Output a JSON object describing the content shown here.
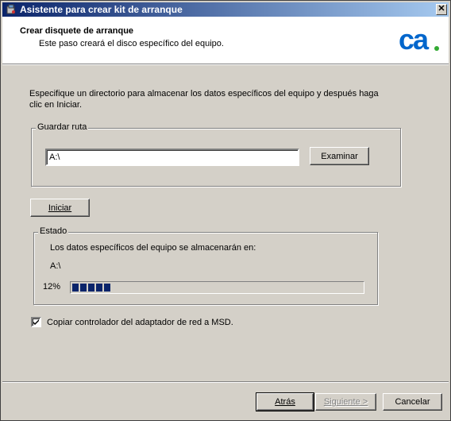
{
  "window": {
    "title": "Asistente para crear kit de arranque",
    "close_glyph": "✕"
  },
  "header": {
    "title": "Crear disquete de arranque",
    "subtitle": "Este paso creará el disco específico del equipo.",
    "logo_text": "ca"
  },
  "instructions": "Especifique un directorio para almacenar los datos específicos del equipo y después haga clic en Iniciar.",
  "save_path": {
    "group_label": "Guardar ruta",
    "value": "A:\\",
    "browse_label": "Examinar"
  },
  "start_button": {
    "label": "Iniciar"
  },
  "status": {
    "group_label": "Estado",
    "message": "Los datos específicos del equipo se almacenarán en:",
    "path": "A:\\",
    "progress_text": "12%",
    "progress": 12
  },
  "copy_driver": {
    "checked": true,
    "label": "Copiar controlador del adaptador de red a MSD."
  },
  "footer": {
    "back_label": "Atrás",
    "next_label": "Siguiente >",
    "cancel_label": "Cancelar"
  },
  "colors": {
    "title_bar": "#0a246a",
    "progress_fill": "#0a246a",
    "logo_blue": "#0066cc",
    "logo_green": "#33aa33"
  },
  "icons": {
    "app": "wizard-app-icon",
    "close": "close-icon",
    "logo": "ca-logo",
    "check": "checkmark-icon"
  }
}
